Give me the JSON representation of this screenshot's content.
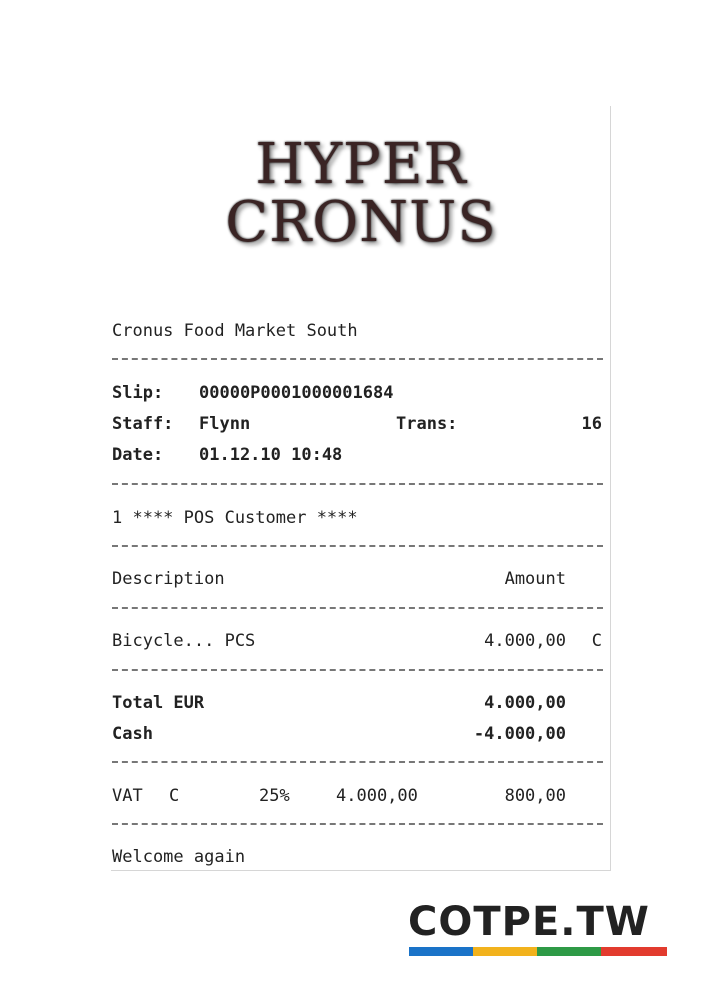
{
  "logo": {
    "line1": "HYPER",
    "line2": "CRONUS"
  },
  "receipt": {
    "store": "Cronus Food Market South",
    "slip_label": "Slip:",
    "slip_value": "00000P0001000001684",
    "staff_label": "Staff:",
    "staff_value": "Flynn",
    "trans_label": "Trans:",
    "trans_value": "16",
    "date_label": "Date:",
    "date_value": "01.12.10 10:48",
    "customer": "1 **** POS Customer ****",
    "col_description": "Description",
    "col_amount": "Amount",
    "item_name": "Bicycle... PCS",
    "item_amount": "4.000,00",
    "item_code": "C",
    "total_label": "Total EUR",
    "total_value": "4.000,00",
    "cash_label": "Cash",
    "cash_value": "-4.000,00",
    "vat_label": "VAT",
    "vat_code": "C",
    "vat_rate": "25%",
    "vat_base": "4.000,00",
    "vat_amount": "800,00",
    "footer": "Welcome again"
  },
  "brand": {
    "name": "COTPE.TW",
    "colors": [
      "#1a73c8",
      "#f2b21c",
      "#2e9a46",
      "#e23b2e"
    ]
  }
}
